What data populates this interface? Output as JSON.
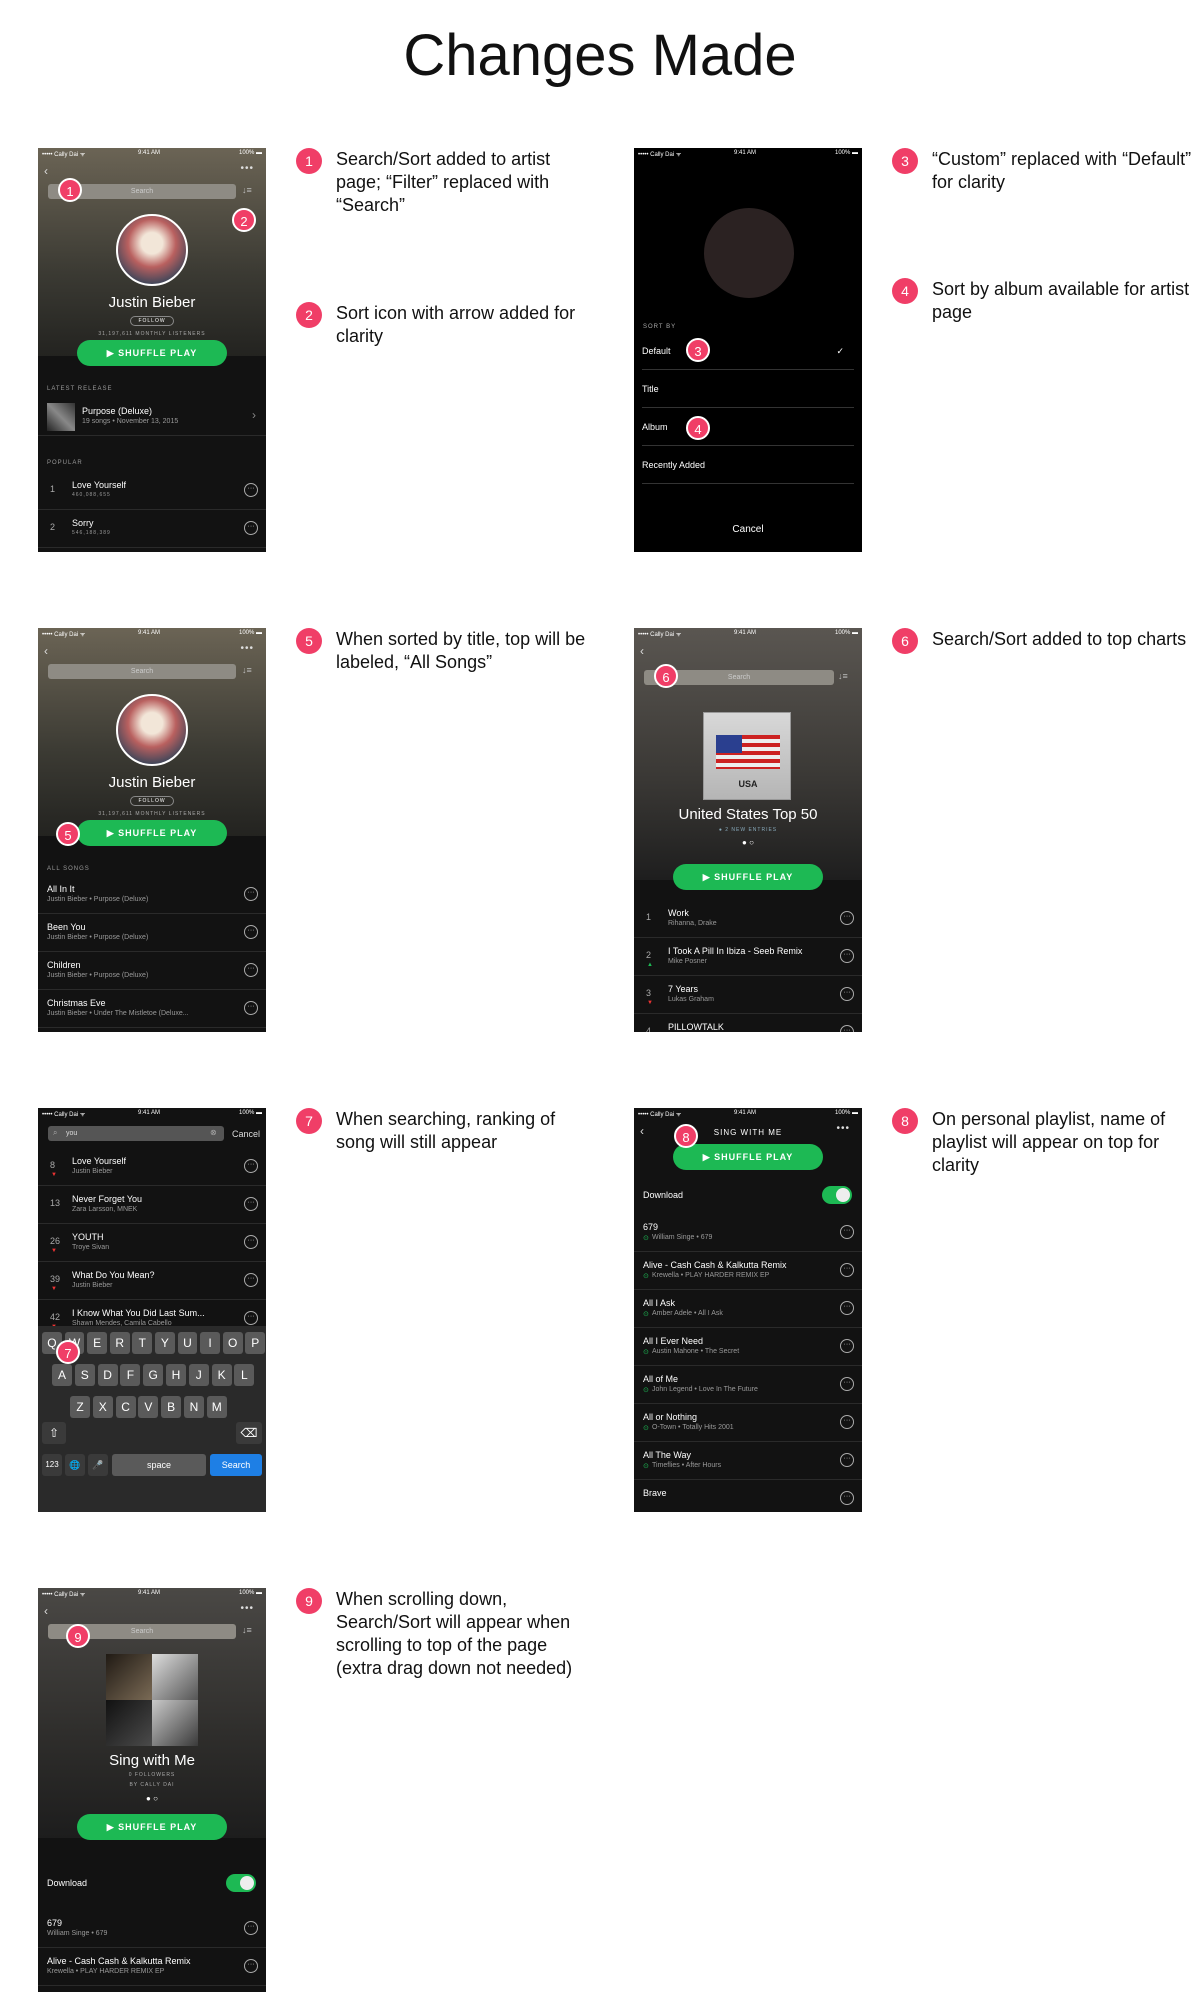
{
  "page": {
    "title": "Changes Made"
  },
  "status": {
    "carrier": "••••• Cally Dai ᯤ",
    "time": "9:41 AM",
    "battery": "100% ▬"
  },
  "icons": {
    "back": "‹",
    "more": "•••",
    "sort": "↓≡",
    "dots": "···",
    "check": "✓",
    "play": "▶"
  },
  "phone1": {
    "search": "Search",
    "artist": "Justin Bieber",
    "follow": "FOLLOW",
    "listeners": "31,197,611 MONTHLY LISTENERS",
    "shuffle": "SHUFFLE PLAY",
    "latest_label": "LATEST RELEASE",
    "latest_title": "Purpose (Deluxe)",
    "latest_sub": "19 songs • November 13, 2015",
    "popular_label": "POPULAR",
    "songs": [
      {
        "n": "1",
        "t": "Love Yourself",
        "s": "460,088,655"
      },
      {
        "n": "2",
        "t": "Sorry",
        "s": "546,188,389"
      }
    ]
  },
  "phone2": {
    "sort_by": "SORT BY",
    "options": [
      "Default",
      "Title",
      "Album",
      "Recently Added"
    ],
    "cancel": "Cancel"
  },
  "phone3": {
    "search": "Search",
    "artist": "Justin Bieber",
    "follow": "FOLLOW",
    "listeners": "31,197,611 MONTHLY LISTENERS",
    "shuffle": "SHUFFLE PLAY",
    "section": "ALL SONGS",
    "songs": [
      {
        "t": "All In It",
        "s": "Justin Bieber • Purpose (Deluxe)"
      },
      {
        "t": "Been You",
        "s": "Justin Bieber • Purpose (Deluxe)"
      },
      {
        "t": "Children",
        "s": "Justin Bieber • Purpose (Deluxe)"
      },
      {
        "t": "Christmas Eve",
        "s": "Justin Bieber • Under The Mistletoe (Deluxe..."
      }
    ]
  },
  "phone4": {
    "search": "Search",
    "art_label": "USA",
    "title": "United States Top 50",
    "entries": "● 2 NEW ENTRIES",
    "shuffle": "SHUFFLE PLAY",
    "songs": [
      {
        "n": "1",
        "t": "Work",
        "s": "Rihanna, Drake"
      },
      {
        "n": "2",
        "t": "I Took A Pill In Ibiza - Seeb Remix",
        "s": "Mike Posner"
      },
      {
        "n": "3",
        "t": "7 Years",
        "s": "Lukas Graham"
      },
      {
        "n": "4",
        "t": "PILLOWTALK",
        "s": ""
      }
    ]
  },
  "phone5": {
    "query": "you",
    "cancel": "Cancel",
    "songs": [
      {
        "n": "8",
        "t": "Love Yourself",
        "s": "Justin Bieber"
      },
      {
        "n": "13",
        "t": "Never Forget You",
        "s": "Zara Larsson, MNEK"
      },
      {
        "n": "26",
        "t": "YOUTH",
        "s": "Troye Sivan"
      },
      {
        "n": "39",
        "t": "What Do You Mean?",
        "s": "Justin Bieber"
      },
      {
        "n": "42",
        "t": "I Know What You Did Last Sum...",
        "s": "Shawn Mendes, Camila Cabello"
      }
    ],
    "row1": [
      "Q",
      "W",
      "E",
      "R",
      "T",
      "Y",
      "U",
      "I",
      "O",
      "P"
    ],
    "row2": [
      "A",
      "S",
      "D",
      "F",
      "G",
      "H",
      "J",
      "K",
      "L"
    ],
    "row3": [
      "Z",
      "X",
      "C",
      "V",
      "B",
      "N",
      "M"
    ],
    "shift": "⇧",
    "del": "⌫",
    "num": "123",
    "globe": "🌐",
    "mic": "🎤",
    "space": "space",
    "go": "Search"
  },
  "phone6": {
    "header": "SING WITH ME",
    "shuffle": "SHUFFLE PLAY",
    "download": "Download",
    "songs": [
      {
        "t": "679",
        "s": "William Singe • 679"
      },
      {
        "t": "Alive - Cash Cash & Kalkutta Remix",
        "s": "Krewella • PLAY HARDER REMIX EP"
      },
      {
        "t": "All I Ask",
        "s": "Amber Adele • All I Ask"
      },
      {
        "t": "All I Ever Need",
        "s": "Austin Mahone • The Secret"
      },
      {
        "t": "All of Me",
        "s": "John Legend • Love In The Future"
      },
      {
        "t": "All or Nothing",
        "s": "O-Town • Totally Hits 2001"
      },
      {
        "t": "All The Way",
        "s": "Timeflies • After Hours"
      },
      {
        "t": "Brave",
        "s": ""
      }
    ]
  },
  "phone7": {
    "search": "Search",
    "title": "Sing with Me",
    "followers": "0 FOLLOWERS",
    "by": "BY CALLY DAI",
    "shuffle": "SHUFFLE PLAY",
    "download": "Download",
    "songs": [
      {
        "t": "679",
        "s": "William Singe • 679"
      },
      {
        "t": "Alive - Cash Cash & Kalkutta Remix",
        "s": "Krewella • PLAY HARDER REMIX EP"
      }
    ]
  },
  "notes": [
    {
      "n": "1",
      "text": "Search/Sort added to artist page; “Filter” replaced with “Search”"
    },
    {
      "n": "2",
      "text": "Sort icon with arrow added for clarity"
    },
    {
      "n": "3",
      "text": "“Custom” replaced with “Default” for clarity"
    },
    {
      "n": "4",
      "text": "Sort by album available for artist page"
    },
    {
      "n": "5",
      "text": " When sorted by title, top will be labeled, “All Songs”"
    },
    {
      "n": "6",
      "text": "Search/Sort added to top charts"
    },
    {
      "n": "7",
      "text": "When searching, ranking of song will still appear"
    },
    {
      "n": "8",
      "text": "On personal playlist, name of playlist will appear on top for clarity"
    },
    {
      "n": "9",
      "text": "When scrolling down, Search/Sort will appear when scrolling to top of the page (extra drag down not needed)"
    }
  ]
}
